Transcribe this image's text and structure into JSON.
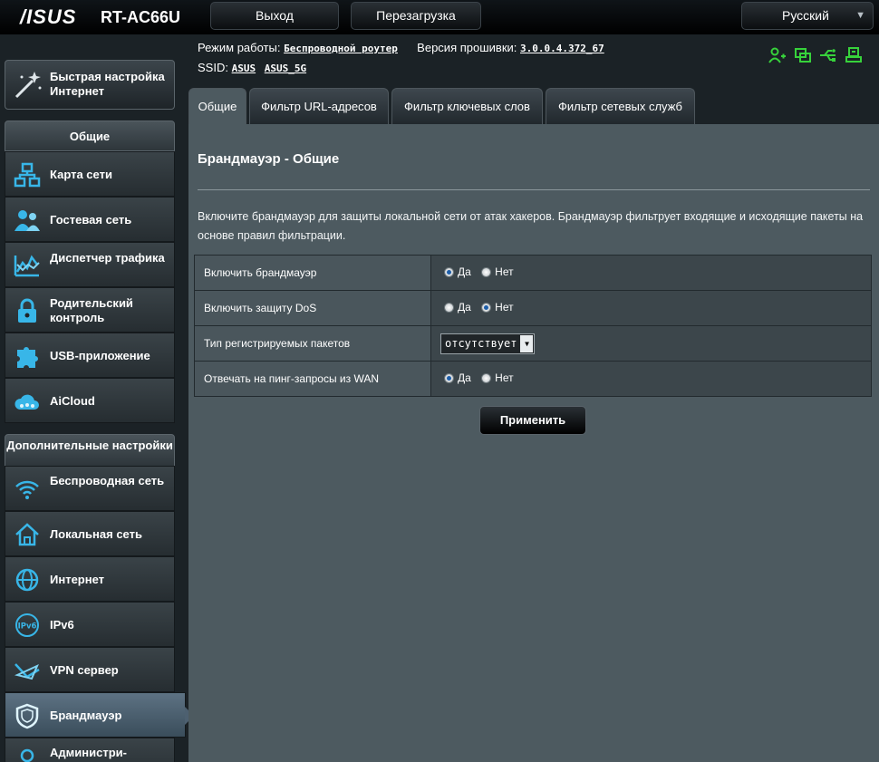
{
  "header": {
    "brand": "/ISUS",
    "model": "RT-AC66U",
    "logout_label": "Выход",
    "reboot_label": "Перезагрузка",
    "language": "Русский"
  },
  "info": {
    "mode_label": "Режим работы:",
    "mode_value": "Беспроводной роутер",
    "firmware_label": "Версия прошивки:",
    "firmware_value": "3.0.0.4.372_67",
    "ssid_label": "SSID:",
    "ssid_1": "ASUS",
    "ssid_2": "ASUS_5G"
  },
  "sidebar": {
    "quick_setup": "Быстрая настройка Интернет",
    "section_general": "Общие",
    "general_items": [
      {
        "label": "Карта сети"
      },
      {
        "label": "Гостевая сеть"
      },
      {
        "label": "Диспетчер трафика"
      },
      {
        "label": "Родительский контроль"
      },
      {
        "label": "USB-приложение"
      },
      {
        "label": "AiCloud"
      }
    ],
    "section_advanced": "Дополнительные настройки",
    "advanced_items": [
      {
        "label": "Беспроводная сеть"
      },
      {
        "label": "Локальная сеть"
      },
      {
        "label": "Интернет"
      },
      {
        "label": "IPv6"
      },
      {
        "label": "VPN сервер"
      },
      {
        "label": "Брандмауэр"
      },
      {
        "label": "Администри-"
      }
    ]
  },
  "tabs": [
    {
      "label": "Общие"
    },
    {
      "label": "Фильтр URL-адресов"
    },
    {
      "label": "Фильтр ключевых слов"
    },
    {
      "label": "Фильтр сетевых служб"
    }
  ],
  "main": {
    "title": "Брандмауэр - Общие",
    "description": "Включите брандмауэр для защиты локальной сети от атак хакеров. Брандмауэр фильтрует входящие и исходящие пакеты на основе правил фильтрации.",
    "yes": "Да",
    "no": "Нет",
    "rows": [
      {
        "label": "Включить брандмауэр",
        "value": "Да"
      },
      {
        "label": "Включить защиту DoS",
        "value": "Нет"
      },
      {
        "label": "Тип регистрируемых пакетов",
        "value": "отсутствует"
      },
      {
        "label": "Отвечать на пинг-запросы из WAN",
        "value": "Да"
      }
    ],
    "apply_label": "Применить"
  },
  "colors": {
    "accent_icon": "#38b6e8",
    "status_green": "#37d23b"
  }
}
